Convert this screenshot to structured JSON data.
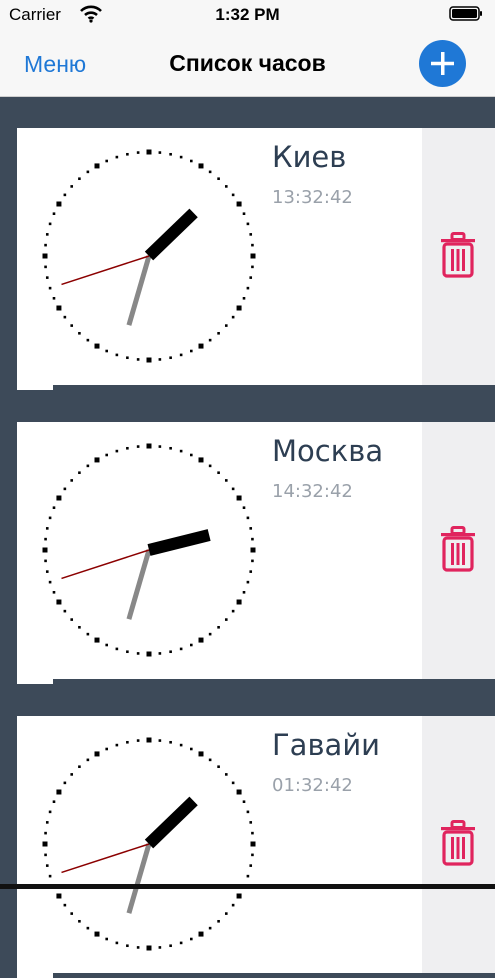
{
  "status": {
    "carrier": "Carrier",
    "time": "1:32 PM"
  },
  "nav": {
    "menu_label": "Меню",
    "title": "Список часов",
    "add_icon": "plus-circle-icon"
  },
  "colors": {
    "accent": "#1f78d6",
    "delete": "#e0245e",
    "background": "#3d4a59"
  },
  "clocks": [
    {
      "city": "Киев",
      "time": "13:32:42",
      "hours": 13,
      "minutes": 32,
      "seconds": 42
    },
    {
      "city": "Москва",
      "time": "14:32:42",
      "hours": 14,
      "minutes": 32,
      "seconds": 42
    },
    {
      "city": "Гавайи",
      "time": "01:32:42",
      "hours": 1,
      "minutes": 32,
      "seconds": 42
    }
  ]
}
